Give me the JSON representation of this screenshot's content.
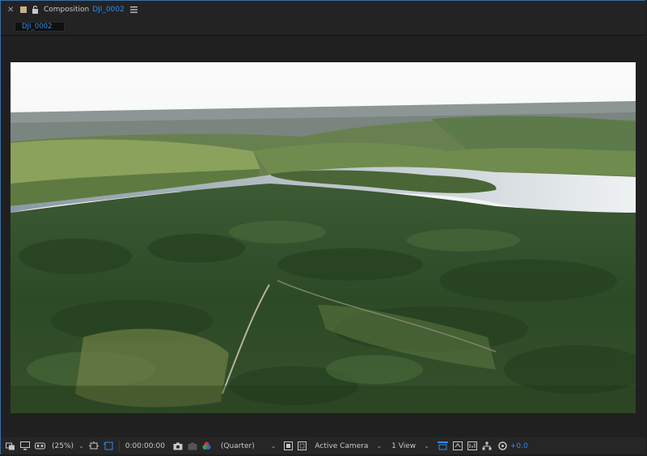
{
  "panel": {
    "title_label": "Composition",
    "comp_name": "DJI_0002"
  },
  "tab": {
    "label": "DJI_0002"
  },
  "status": {
    "zoom": "(25%)",
    "timecode": "0:00:00:00",
    "resolution": "(Quarter)",
    "camera": "Active Camera",
    "views": "1 View",
    "exposure": "+0.0"
  },
  "colors": {
    "accent": "#2f8bf0",
    "panel": "#232323",
    "frame": "#3b6ea5"
  }
}
